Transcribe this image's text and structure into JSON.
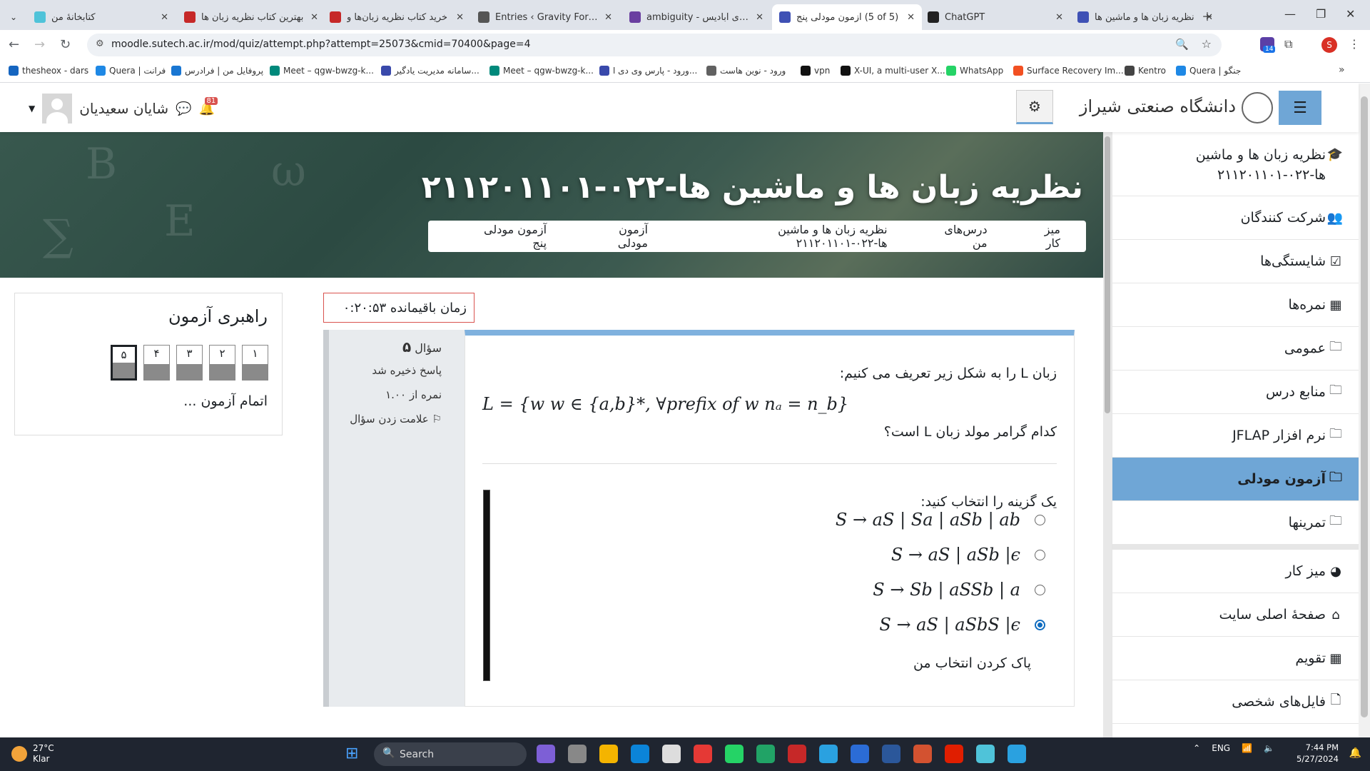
{
  "browser": {
    "tabs": [
      {
        "title": "کتابخانهٔ من",
        "color": "#4fc3d9"
      },
      {
        "title": "بهترین کتاب نظریه زبان ها",
        "color": "#c62828"
      },
      {
        "title": "خرید کتاب نظریه زبان‌ها و",
        "color": "#c62828"
      },
      {
        "title": "Entries ‹ Gravity Forms ‹",
        "color": "#555555"
      },
      {
        "title": "ambiguity - دیکشنری آبادیس",
        "color": "#6a3fa0"
      },
      {
        "title": "آزمون مودلی پنج (5 of 5)",
        "color": "#3f51b5",
        "active": true
      },
      {
        "title": "ChatGPT",
        "color": "#222222"
      },
      {
        "title": "نظریه زبان ها و ماشین ها",
        "color": "#3f51b5"
      }
    ],
    "url": "moodle.sutech.ac.ir/mod/quiz/attempt.php?attempt=25073&cmid=70400&page=4",
    "extension_badge": "14",
    "profile_initial": "S",
    "bookmarks": [
      {
        "label": "thesheox - dars",
        "color": "#1565c0"
      },
      {
        "label": "Quera | فرانت",
        "color": "#1e88e5"
      },
      {
        "label": "پروفایل من | فرادرس",
        "color": "#1976d2"
      },
      {
        "label": "Meet – qgw-bwzg-k...",
        "color": "#00897b"
      },
      {
        "label": "سامانه مدیریت یادگیر...",
        "color": "#3949ab"
      },
      {
        "label": "Meet – qgw-bwzg-k...",
        "color": "#00897b"
      },
      {
        "label": "ورود - پارس وی دی ا...",
        "color": "#3949ab"
      },
      {
        "label": "ورود - نوین هاست",
        "color": "#616161"
      },
      {
        "label": "vpn",
        "color": "#111111"
      },
      {
        "label": "X-UI, a multi-user X...",
        "color": "#111111"
      },
      {
        "label": "WhatsApp",
        "color": "#25d366"
      },
      {
        "label": "Surface Recovery Im...",
        "color": "#f25022"
      },
      {
        "label": "Kentro",
        "color": "#444444"
      },
      {
        "label": "Quera | جنگو",
        "color": "#1e88e5"
      }
    ]
  },
  "moodle": {
    "site_name": "دانشگاه صنعتی شیراز",
    "user_name": "شایان سعیدیان",
    "notification_count": "81",
    "course_title": "نظریه زبان ها و ماشین ها-۰۲۲-۲۱۱۲۰۱۱۰۱",
    "breadcrumb": [
      "میز کار",
      "درس‌های من",
      "نظریه زبان ها و ماشین ها-۰۲۲-۲۱۱۲۰۱۱۰۱",
      "آزمون مودلی",
      "آزمون مودلی پنج"
    ],
    "sidebar": [
      {
        "label": "نظریه زبان ها و ماشین ها-۰۲۲-۲۱۱۲۰۱۱۰۱",
        "icon": "graduation-cap-icon",
        "glyph": "🎓"
      },
      {
        "label": "شرکت کنندگان",
        "icon": "users-icon",
        "glyph": "👥"
      },
      {
        "label": "شایستگی‌ها",
        "icon": "check-square-icon",
        "glyph": "☑"
      },
      {
        "label": "نمره‌ها",
        "icon": "table-icon",
        "glyph": "▦"
      },
      {
        "label": "عمومی",
        "icon": "folder-icon",
        "glyph": "🗀"
      },
      {
        "label": "منابع درس",
        "icon": "folder-icon",
        "glyph": "🗀"
      },
      {
        "label": "نرم افزار JFLAP",
        "icon": "folder-icon",
        "glyph": "🗀"
      },
      {
        "label": "آزمون مودلی",
        "icon": "folder-icon",
        "glyph": "🗀",
        "active": true
      },
      {
        "label": "تمرینها",
        "icon": "folder-icon",
        "glyph": "🗀"
      }
    ],
    "sidebar2": [
      {
        "label": "میز کار",
        "icon": "dashboard-icon",
        "glyph": "◕"
      },
      {
        "label": "صفحهٔ اصلی سایت",
        "icon": "home-icon",
        "glyph": "⌂"
      },
      {
        "label": "تقویم",
        "icon": "calendar-icon",
        "glyph": "▦"
      },
      {
        "label": "فایل‌های شخصی",
        "icon": "file-icon",
        "glyph": "🗋"
      }
    ],
    "quiz_nav": {
      "title": "راهبری آزمون",
      "questions": [
        "۱",
        "۲",
        "۳",
        "۴",
        "۵"
      ],
      "current": 4,
      "finish": "اتمام آزمون ..."
    },
    "timer": "زمان باقیمانده ۰:۲۰:۵۳",
    "question": {
      "number_label": "سؤال",
      "number": "۵",
      "state": "پاسخ ذخیره شد",
      "mark": "نمره از ۱.۰۰",
      "flag": "علامت زدن سؤال",
      "text1": "زبان L را به شکل زیر تعریف می کنیم:",
      "formula": "L = {w w ∈ {a,b}*, ∀prefix of w nₐ = n_b}",
      "text2": "کدام گرامر مولد زبان L است؟",
      "prompt": "یک گزینه را انتخاب کنید:",
      "options": [
        {
          "text": "S → aS | Sa | aSb | ab",
          "selected": false
        },
        {
          "text": "S → aS | aSb |ϵ",
          "selected": false
        },
        {
          "text": "S → Sb | aSSb | a",
          "selected": false
        },
        {
          "text": "S → aS | aSbS |ϵ",
          "selected": true
        }
      ],
      "clear": "پاک کردن انتخاب من"
    }
  },
  "taskbar": {
    "weather_temp": "27°C",
    "weather_desc": "Klar",
    "search_label": "Search",
    "language": "ENG",
    "time": "7:44 PM",
    "date": "5/27/2024"
  }
}
